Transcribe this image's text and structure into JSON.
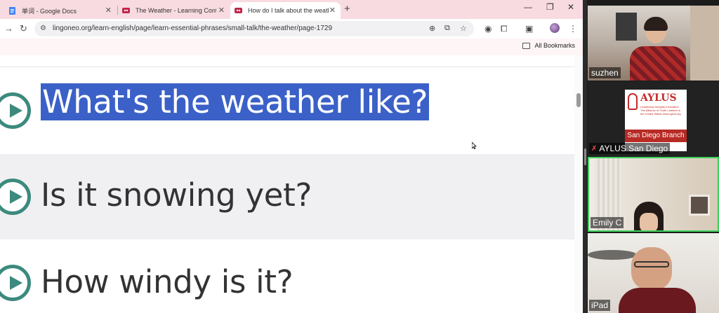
{
  "browser": {
    "tabs": [
      {
        "title": "单词 - Google Docs",
        "icon": "google-docs-icon",
        "active": false
      },
      {
        "title": "The Weather - Learning Content",
        "icon": "lingoneo-icon",
        "active": false
      },
      {
        "title": "How do I talk about the weather",
        "icon": "lingoneo-icon",
        "active": true
      }
    ],
    "new_tab_label": "+",
    "window_controls": {
      "minimize": "—",
      "maximize": "❐",
      "close": "✕"
    },
    "url": "lingoneo.org/learn-english/page/learn-essential-phrases/small-talk/the-weather/page-1729",
    "bookmarks_label": "All Bookmarks",
    "extension_badge": "9"
  },
  "page": {
    "phrases": [
      {
        "text": "What's the weather like?",
        "highlighted": true
      },
      {
        "text": "Is it snowing yet?",
        "highlighted": false
      },
      {
        "text": "How windy is it?",
        "highlighted": false
      }
    ]
  },
  "video_call": {
    "participants": [
      {
        "name": "suzhen",
        "muted": false,
        "speaking": false
      },
      {
        "name": "AYLUS San Diego",
        "muted": true,
        "speaking": false
      },
      {
        "name": "Emily C",
        "muted": false,
        "speaking": true
      },
      {
        "name": "iPad",
        "muted": false,
        "speaking": false
      }
    ],
    "logo": {
      "word": "AYLUS",
      "subtitle": "Leadership Integrity Innovation The Alliance of Youth Leaders in the United States www.aylus.org",
      "branch": "San Diego Branch"
    }
  },
  "colors": {
    "tabbar": "#f8dbe0",
    "highlight": "#3b61c8",
    "play_button": "#3c8a7e",
    "speaking_border": "#3bd15a"
  }
}
